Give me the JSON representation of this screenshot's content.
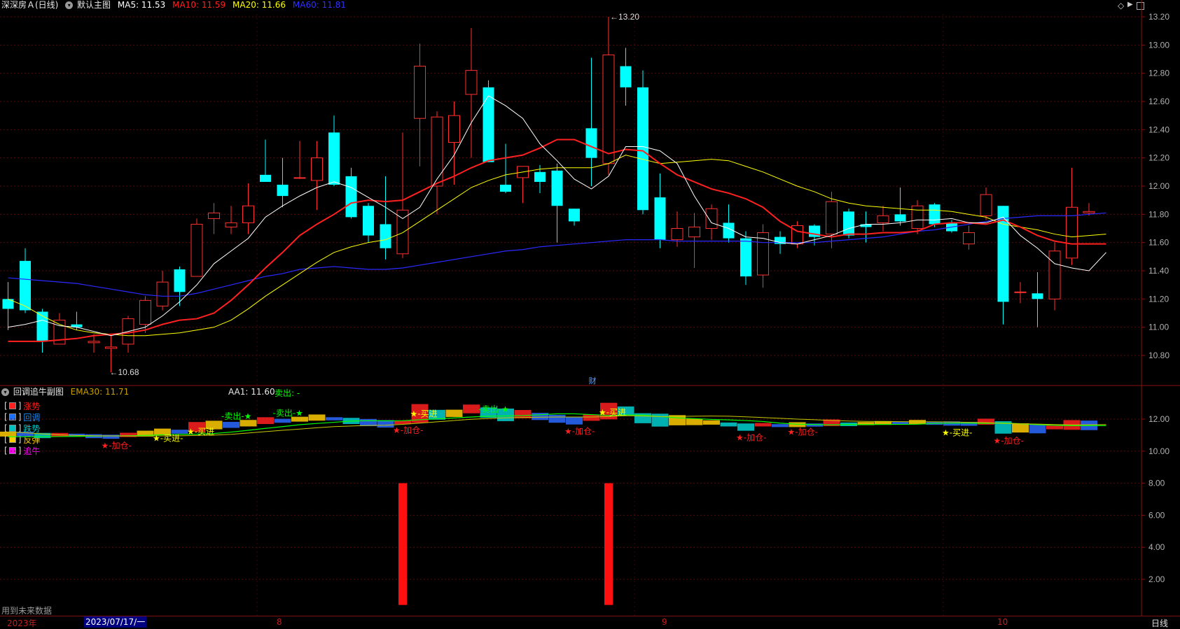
{
  "main": {
    "stock_title": "深深房Ａ(日线)",
    "template_label": "默认主图",
    "ma": [
      {
        "label": "MA5: 11.53",
        "color": "#ffffff"
      },
      {
        "label": "MA10: 11.59",
        "color": "#ff2020"
      },
      {
        "label": "MA20: 11.66",
        "color": "#ffff00"
      },
      {
        "label": "MA60: 11.81",
        "color": "#2020ff"
      }
    ],
    "high_label": "13.20",
    "low_label": "10.68",
    "finance_marker": "财"
  },
  "sub": {
    "indicator_name": "回调追牛副图",
    "ema_label": "EMA30: 11.71",
    "aa1_label": "AA1: 11.60",
    "sell_label": "卖出: -",
    "legend": [
      {
        "label": "涨势",
        "color": "#ff2020",
        "text_color": "#ff2020"
      },
      {
        "label": "回调",
        "color": "#1a6fff",
        "text_color": "#1a8fff"
      },
      {
        "label": "跌势",
        "color": "#00c0c0",
        "text_color": "#00c8c8"
      },
      {
        "label": "反弹",
        "color": "#ffcc00",
        "text_color": "#ffcc00"
      },
      {
        "label": "追牛",
        "color": "#ff00ff",
        "text_color": "#ff00ff"
      }
    ],
    "note": "用到未来数据",
    "signals": [
      {
        "text": "★-加仓-",
        "color": "#ff2020",
        "i": 6
      },
      {
        "text": "★-买进-",
        "color": "#ffff00",
        "i": 9
      },
      {
        "text": "★-买进",
        "color": "#ffff00",
        "i": 11
      },
      {
        "text": "-卖出-★",
        "color": "#00ff00",
        "i": 13
      },
      {
        "text": "-卖出-★",
        "color": "#00ff00",
        "i": 16
      },
      {
        "text": "★-加仓-",
        "color": "#ff2020",
        "i": 23
      },
      {
        "text": "★-买进",
        "color": "#ffff00",
        "i": 24
      },
      {
        "text": "-卖出-★",
        "color": "#00ff00",
        "i": 28
      },
      {
        "text": "★-加仓-",
        "color": "#ff2020",
        "i": 33
      },
      {
        "text": "★-买进",
        "color": "#ffff00",
        "i": 35
      },
      {
        "text": "★-加仓-",
        "color": "#ff2020",
        "i": 43
      },
      {
        "text": "★-加仓-",
        "color": "#ff2020",
        "i": 46
      },
      {
        "text": "★-买进-",
        "color": "#ffff00",
        "i": 55
      },
      {
        "text": "★-加仓-",
        "color": "#ff2020",
        "i": 58
      }
    ]
  },
  "axis_main_ticks": [
    "13.20",
    "13.00",
    "12.80",
    "12.60",
    "12.40",
    "12.20",
    "12.00",
    "11.80",
    "11.60",
    "11.40",
    "11.20",
    "11.00",
    "10.80"
  ],
  "axis_sub_ticks": [
    "12.00",
    "10.00",
    "8.00",
    "6.00",
    "4.00",
    "2.00"
  ],
  "timeline": {
    "year_label": "2023年",
    "date_label": "2023/07/17/一",
    "months": [
      "8",
      "9",
      "10"
    ],
    "period_label": "日线"
  },
  "chart_data": {
    "type": "candlestick",
    "title": "深深房Ａ(日线)",
    "ylim": [
      10.5,
      13.3
    ],
    "up_color": "#ff3030",
    "down_color": "#00ffff",
    "candles": [
      {
        "o": 11.2,
        "h": 11.32,
        "l": 10.98,
        "c": 11.13
      },
      {
        "o": 11.47,
        "h": 11.56,
        "l": 11.1,
        "c": 11.12
      },
      {
        "o": 11.11,
        "h": 11.13,
        "l": 10.82,
        "c": 10.9
      },
      {
        "o": 10.88,
        "h": 11.1,
        "l": 10.88,
        "c": 11.05
      },
      {
        "o": 11.02,
        "h": 11.11,
        "l": 10.98,
        "c": 11.0
      },
      {
        "o": 10.89,
        "h": 10.95,
        "l": 10.82,
        "c": 10.9
      },
      {
        "o": 10.85,
        "h": 10.95,
        "l": 10.68,
        "c": 10.86
      },
      {
        "o": 10.88,
        "h": 11.08,
        "l": 10.82,
        "c": 11.06
      },
      {
        "o": 11.02,
        "h": 11.22,
        "l": 10.96,
        "c": 11.19
      },
      {
        "o": 11.15,
        "h": 11.4,
        "l": 11.12,
        "c": 11.32
      },
      {
        "o": 11.41,
        "h": 11.43,
        "l": 11.15,
        "c": 11.25
      },
      {
        "o": 11.36,
        "h": 11.77,
        "l": 11.36,
        "c": 11.73
      },
      {
        "o": 11.77,
        "h": 11.88,
        "l": 11.66,
        "c": 11.81
      },
      {
        "o": 11.71,
        "h": 11.86,
        "l": 11.66,
        "c": 11.74
      },
      {
        "o": 11.74,
        "h": 12.02,
        "l": 11.66,
        "c": 11.86
      },
      {
        "o": 12.08,
        "h": 12.33,
        "l": 12.03,
        "c": 12.03
      },
      {
        "o": 12.01,
        "h": 12.2,
        "l": 11.85,
        "c": 11.93
      },
      {
        "o": 12.06,
        "h": 12.32,
        "l": 12.05,
        "c": 12.06
      },
      {
        "o": 12.04,
        "h": 12.32,
        "l": 11.83,
        "c": 12.2
      },
      {
        "o": 12.38,
        "h": 12.5,
        "l": 12.0,
        "c": 12.01
      },
      {
        "o": 12.07,
        "h": 12.13,
        "l": 11.77,
        "c": 11.78
      },
      {
        "o": 11.86,
        "h": 11.88,
        "l": 11.6,
        "c": 11.65
      },
      {
        "o": 11.73,
        "h": 12.07,
        "l": 11.48,
        "c": 11.56
      },
      {
        "o": 11.52,
        "h": 12.38,
        "l": 11.49,
        "c": 11.83
      },
      {
        "o": 12.48,
        "h": 13.01,
        "l": 12.14,
        "c": 12.85
      },
      {
        "o": 12.0,
        "h": 12.53,
        "l": 11.8,
        "c": 12.49
      },
      {
        "o": 12.31,
        "h": 12.6,
        "l": 12.01,
        "c": 12.5
      },
      {
        "o": 12.65,
        "h": 13.12,
        "l": 12.2,
        "c": 12.82
      },
      {
        "o": 12.7,
        "h": 12.75,
        "l": 12.17,
        "c": 12.17
      },
      {
        "o": 12.01,
        "h": 12.3,
        "l": 11.95,
        "c": 11.96
      },
      {
        "o": 12.06,
        "h": 12.14,
        "l": 11.88,
        "c": 12.14
      },
      {
        "o": 12.1,
        "h": 12.15,
        "l": 11.95,
        "c": 12.03
      },
      {
        "o": 12.11,
        "h": 12.16,
        "l": 11.6,
        "c": 11.86
      },
      {
        "o": 11.84,
        "h": 11.84,
        "l": 11.72,
        "c": 11.75
      },
      {
        "o": 12.41,
        "h": 12.91,
        "l": 12.0,
        "c": 12.2
      },
      {
        "o": 12.16,
        "h": 13.2,
        "l": 12.08,
        "c": 12.93
      },
      {
        "o": 12.85,
        "h": 12.98,
        "l": 12.57,
        "c": 12.7
      },
      {
        "o": 12.7,
        "h": 12.82,
        "l": 11.8,
        "c": 11.83
      },
      {
        "o": 11.92,
        "h": 12.09,
        "l": 11.56,
        "c": 11.62
      },
      {
        "o": 11.62,
        "h": 11.82,
        "l": 11.57,
        "c": 11.7
      },
      {
        "o": 11.64,
        "h": 11.81,
        "l": 11.42,
        "c": 11.71
      },
      {
        "o": 11.7,
        "h": 11.87,
        "l": 11.62,
        "c": 11.84
      },
      {
        "o": 11.74,
        "h": 11.87,
        "l": 11.6,
        "c": 11.63
      },
      {
        "o": 11.63,
        "h": 11.68,
        "l": 11.3,
        "c": 11.36
      },
      {
        "o": 11.37,
        "h": 11.73,
        "l": 11.28,
        "c": 11.67
      },
      {
        "o": 11.64,
        "h": 11.68,
        "l": 11.52,
        "c": 11.59
      },
      {
        "o": 11.59,
        "h": 11.75,
        "l": 11.56,
        "c": 11.72
      },
      {
        "o": 11.72,
        "h": 11.73,
        "l": 11.58,
        "c": 11.64
      },
      {
        "o": 11.66,
        "h": 11.96,
        "l": 11.56,
        "c": 11.89
      },
      {
        "o": 11.82,
        "h": 11.84,
        "l": 11.63,
        "c": 11.65
      },
      {
        "o": 11.73,
        "h": 11.82,
        "l": 11.6,
        "c": 11.71
      },
      {
        "o": 11.74,
        "h": 11.86,
        "l": 11.68,
        "c": 11.79
      },
      {
        "o": 11.8,
        "h": 11.99,
        "l": 11.72,
        "c": 11.75
      },
      {
        "o": 11.7,
        "h": 11.9,
        "l": 11.66,
        "c": 11.86
      },
      {
        "o": 11.87,
        "h": 11.88,
        "l": 11.71,
        "c": 11.73
      },
      {
        "o": 11.74,
        "h": 11.76,
        "l": 11.67,
        "c": 11.68
      },
      {
        "o": 11.59,
        "h": 11.72,
        "l": 11.55,
        "c": 11.67
      },
      {
        "o": 11.79,
        "h": 11.99,
        "l": 11.76,
        "c": 11.94
      },
      {
        "o": 11.86,
        "h": 11.86,
        "l": 11.02,
        "c": 11.18
      },
      {
        "o": 11.25,
        "h": 11.32,
        "l": 11.17,
        "c": 11.25
      },
      {
        "o": 11.24,
        "h": 11.39,
        "l": 11.0,
        "c": 11.2
      },
      {
        "o": 11.2,
        "h": 11.6,
        "l": 11.12,
        "c": 11.54
      },
      {
        "o": 11.49,
        "h": 12.13,
        "l": 11.44,
        "c": 11.85
      },
      {
        "o": 11.81,
        "h": 11.88,
        "l": 11.79,
        "c": 11.82
      }
    ],
    "ma5": [
      11.0,
      11.02,
      11.05,
      11.01,
      11.0,
      10.97,
      10.94,
      10.97,
      11.0,
      11.08,
      11.18,
      11.3,
      11.45,
      11.54,
      11.63,
      11.78,
      11.86,
      11.93,
      11.99,
      12.03,
      11.99,
      11.92,
      11.85,
      11.77,
      11.85,
      12.05,
      12.22,
      12.45,
      12.64,
      12.57,
      12.48,
      12.3,
      12.18,
      12.05,
      11.98,
      12.07,
      12.28,
      12.28,
      12.25,
      12.16,
      11.93,
      11.74,
      11.7,
      11.64,
      11.63,
      11.6,
      11.59,
      11.62,
      11.65,
      11.7,
      11.73,
      11.73,
      11.74,
      11.76,
      11.76,
      11.77,
      11.74,
      11.74,
      11.78,
      11.65,
      11.56,
      11.45,
      11.42,
      11.4,
      11.53
    ],
    "ma10": [
      10.9,
      10.9,
      10.9,
      10.91,
      10.92,
      10.94,
      10.95,
      10.96,
      10.98,
      11.02,
      11.05,
      11.06,
      11.1,
      11.19,
      11.3,
      11.42,
      11.53,
      11.65,
      11.73,
      11.8,
      11.88,
      11.9,
      11.89,
      11.9,
      11.96,
      12.02,
      12.07,
      12.13,
      12.18,
      12.2,
      12.22,
      12.27,
      12.33,
      12.33,
      12.28,
      12.23,
      12.26,
      12.25,
      12.16,
      12.08,
      12.03,
      11.98,
      11.95,
      11.91,
      11.85,
      11.75,
      11.68,
      11.66,
      11.64,
      11.66,
      11.66,
      11.67,
      11.67,
      11.68,
      11.73,
      11.74,
      11.74,
      11.73,
      11.76,
      11.71,
      11.65,
      11.61,
      11.59,
      11.59,
      11.59
    ],
    "ma20": [
      11.2,
      11.15,
      11.08,
      11.02,
      10.98,
      10.96,
      10.95,
      10.94,
      10.94,
      10.95,
      10.96,
      10.98,
      11.0,
      11.05,
      11.13,
      11.22,
      11.3,
      11.38,
      11.46,
      11.53,
      11.57,
      11.6,
      11.62,
      11.67,
      11.75,
      11.83,
      11.91,
      11.99,
      12.04,
      12.08,
      12.1,
      12.12,
      12.13,
      12.13,
      12.13,
      12.16,
      12.22,
      12.19,
      12.16,
      12.17,
      12.18,
      12.19,
      12.18,
      12.14,
      12.1,
      12.05,
      12.0,
      11.96,
      11.91,
      11.88,
      11.86,
      11.85,
      11.84,
      11.83,
      11.83,
      11.82,
      11.8,
      11.78,
      11.73,
      11.71,
      11.69,
      11.66,
      11.64,
      11.65,
      11.66
    ],
    "ma60": [
      11.35,
      11.34,
      11.33,
      11.32,
      11.31,
      11.29,
      11.27,
      11.25,
      11.23,
      11.22,
      11.22,
      11.24,
      11.27,
      11.3,
      11.33,
      11.36,
      11.38,
      11.41,
      11.42,
      11.43,
      11.42,
      11.41,
      11.41,
      11.42,
      11.44,
      11.46,
      11.48,
      11.5,
      11.52,
      11.54,
      11.55,
      11.57,
      11.58,
      11.59,
      11.6,
      11.61,
      11.62,
      11.62,
      11.62,
      11.61,
      11.61,
      11.61,
      11.61,
      11.61,
      11.6,
      11.6,
      11.6,
      11.6,
      11.61,
      11.62,
      11.63,
      11.64,
      11.66,
      11.68,
      11.69,
      11.71,
      11.73,
      11.75,
      11.77,
      11.78,
      11.79,
      11.79,
      11.79,
      11.8,
      11.81
    ],
    "sub_bars": [
      {
        "i": 23,
        "value": 8.0,
        "color": "#ff1010"
      },
      {
        "i": 35,
        "value": 8.0,
        "color": "#ff1010"
      }
    ],
    "sub_ylim": [
      0,
      13.2
    ]
  }
}
